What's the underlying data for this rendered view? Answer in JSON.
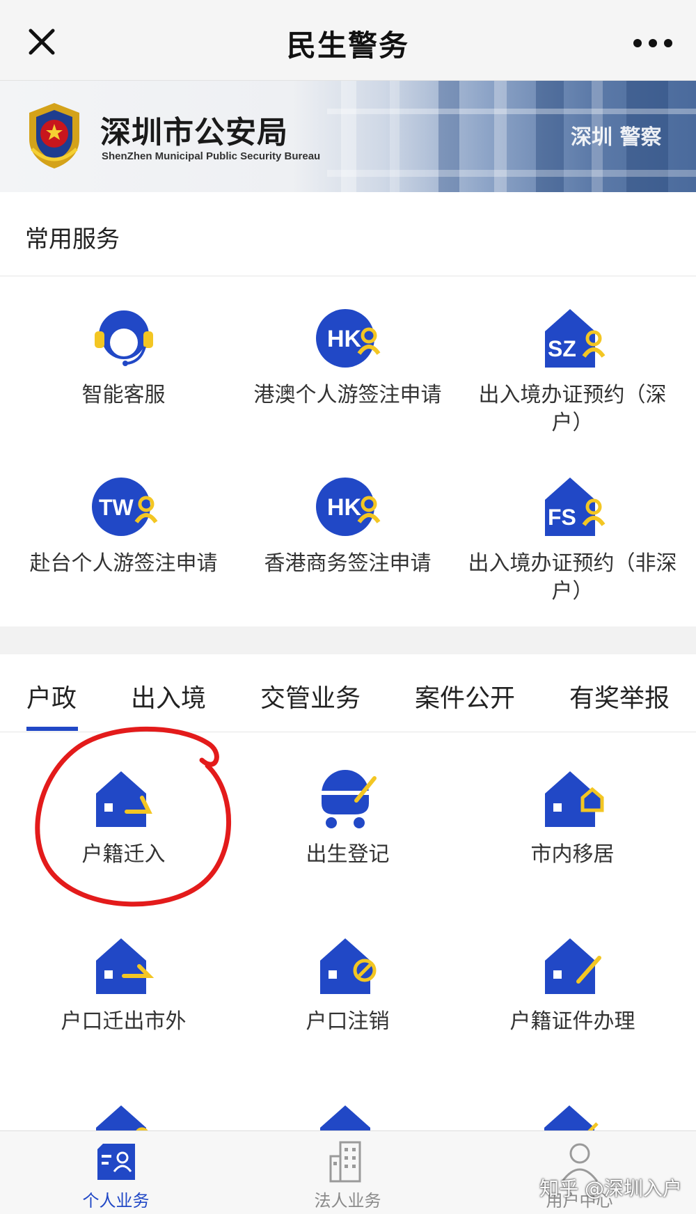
{
  "header": {
    "title": "民生警务",
    "close_icon": "close-icon",
    "more_icon": "more-icon"
  },
  "banner": {
    "title_cn": "深圳市公安局",
    "title_en": "ShenZhen Municipal Public Security Bureau",
    "plate_text": "深圳 警察"
  },
  "common_services": {
    "title": "常用服务",
    "items": [
      {
        "label": "智能客服",
        "icon": "customer-service-icon"
      },
      {
        "label": "港澳个人游签注申请",
        "icon": "hk-visa-icon"
      },
      {
        "label": "出入境办证预约（深户）",
        "icon": "sz-appointment-icon"
      },
      {
        "label": "赴台个人游签注申请",
        "icon": "tw-visa-icon"
      },
      {
        "label": "香港商务签注申请",
        "icon": "hk-business-icon"
      },
      {
        "label": "出入境办证预约（非深户）",
        "icon": "fs-appointment-icon"
      }
    ]
  },
  "tabs": [
    {
      "label": "户政",
      "active": true
    },
    {
      "label": "出入境",
      "active": false
    },
    {
      "label": "交管业务",
      "active": false
    },
    {
      "label": "案件公开",
      "active": false
    },
    {
      "label": "有奖举报",
      "active": false
    }
  ],
  "household_services": [
    {
      "label": "户籍迁入",
      "icon": "house-move-in-icon"
    },
    {
      "label": "出生登记",
      "icon": "stroller-icon"
    },
    {
      "label": "市内移居",
      "icon": "house-relocate-icon"
    },
    {
      "label": "户口迁出市外",
      "icon": "house-move-out-icon"
    },
    {
      "label": "户口注销",
      "icon": "house-cancel-icon"
    },
    {
      "label": "户籍证件办理",
      "icon": "house-certificate-icon"
    }
  ],
  "bottom_nav": [
    {
      "label": "个人业务",
      "icon": "personal-id-icon",
      "active": true
    },
    {
      "label": "法人业务",
      "icon": "building-icon",
      "active": false
    },
    {
      "label": "用户中心",
      "icon": "user-icon",
      "active": false
    }
  ],
  "watermark": "知乎 @深圳入户",
  "colors": {
    "brand_blue": "#2148c6",
    "accent_yellow": "#f3c623",
    "annotation_red": "#e31b1b"
  }
}
